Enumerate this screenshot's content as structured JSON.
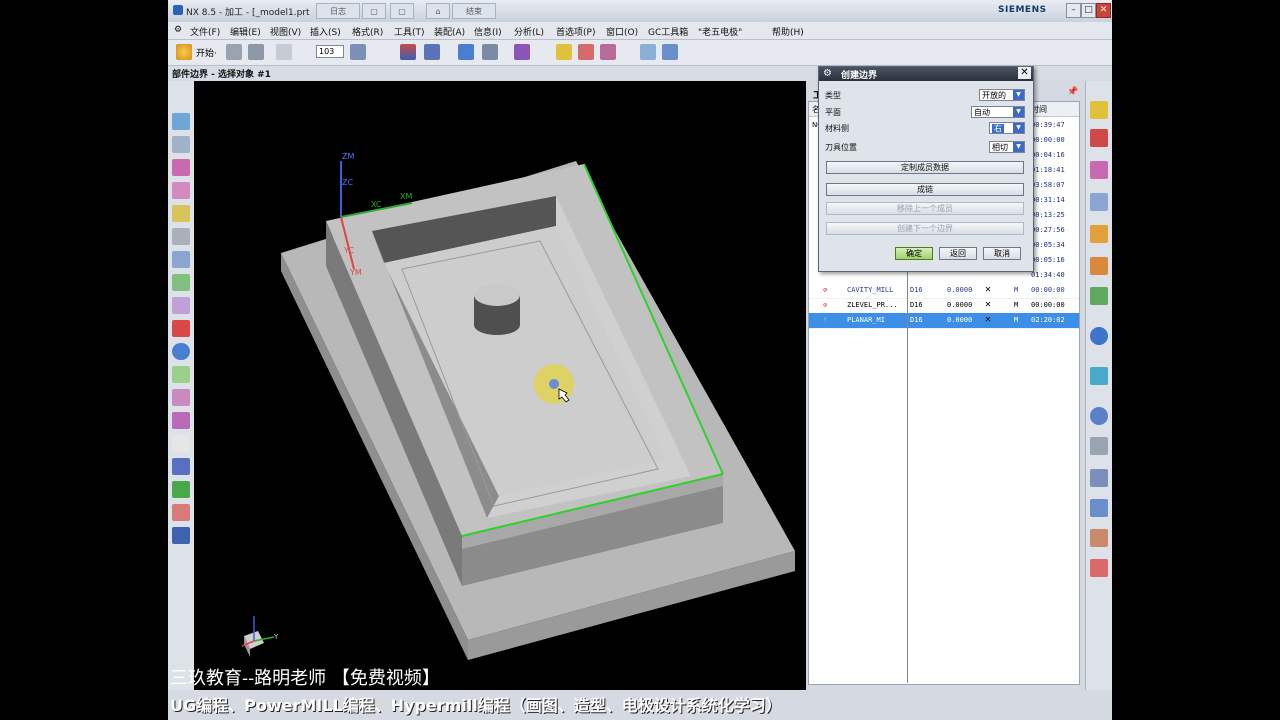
{
  "window": {
    "title": "NX 8.5 - 加工 - [_model1.prt",
    "quick_buttons": [
      "日志",
      "",
      "",
      "",
      "结束"
    ],
    "brand": "SIEMENS"
  },
  "menu": [
    "文件(F)",
    "编辑(E)",
    "视图(V)",
    "插入(S)",
    "格式(R)",
    "工具(T)",
    "装配(A)",
    "信息(I)",
    "分析(L)",
    "首选项(P)",
    "窗口(O)",
    "GC工具箱",
    "\"老五电极\"",
    "帮助(H)"
  ],
  "toolbar": {
    "start_label": "开始·",
    "zoom_value": "103"
  },
  "status_prompt": "部件边界 - 选择对象 #1",
  "dialog": {
    "title": "创建边界",
    "fields": [
      {
        "label": "类型",
        "value": "开放的"
      },
      {
        "label": "平面",
        "value": "自动"
      },
      {
        "label": "材料侧",
        "value": "右"
      },
      {
        "label": "刀具位置",
        "value": "相切"
      }
    ],
    "buttons": {
      "custom_member": "定制成员数据",
      "chain": "成链",
      "remove_last": "移除上一个成员",
      "create_next": "创建下一个边界"
    },
    "ok": "确定",
    "back": "返回",
    "cancel": "取消"
  },
  "navigator": {
    "header_left": "工",
    "header_col": "名",
    "header_time": "时间",
    "nc_label": "NC",
    "times": [
      "00:39:47",
      "00:00:00",
      "00:04:16",
      "01:18:41",
      "03:58:07",
      "00:31:14",
      "00:13:25",
      "00:27:56",
      "00:05:34",
      "00:05:16",
      "01:34:40"
    ],
    "rows": [
      {
        "name": "CAVITY_MILL",
        "tool": "D16",
        "offset": "0.0000",
        "geom": "M",
        "time": "00:00:00",
        "selected": false
      },
      {
        "name": "ZLEVEL_PR...",
        "tool": "D16",
        "offset": "0.0000",
        "geom": "M",
        "time": "00:00:00",
        "selected": false
      },
      {
        "name": "PLANAR_MI",
        "tool": "D16",
        "offset": "0.0000",
        "geom": "M",
        "time": "02:20:02",
        "selected": true
      }
    ]
  },
  "axes": {
    "zm": "ZM",
    "zc": "ZC",
    "xm": "XM",
    "xc": "XC",
    "yc": "YC",
    "ym": "YM",
    "y": "Y"
  },
  "captions": {
    "line1": "三玖教育--路明老师 【免费视频】",
    "line2": "UG编程、PowerMILL编程、Hypermill编程（画图、造型、电极设计系统化学习）"
  },
  "colors": {
    "accent": "#3d8ee6",
    "edge_highlight": "#2ed12e",
    "viewport_bg": "#000000"
  }
}
